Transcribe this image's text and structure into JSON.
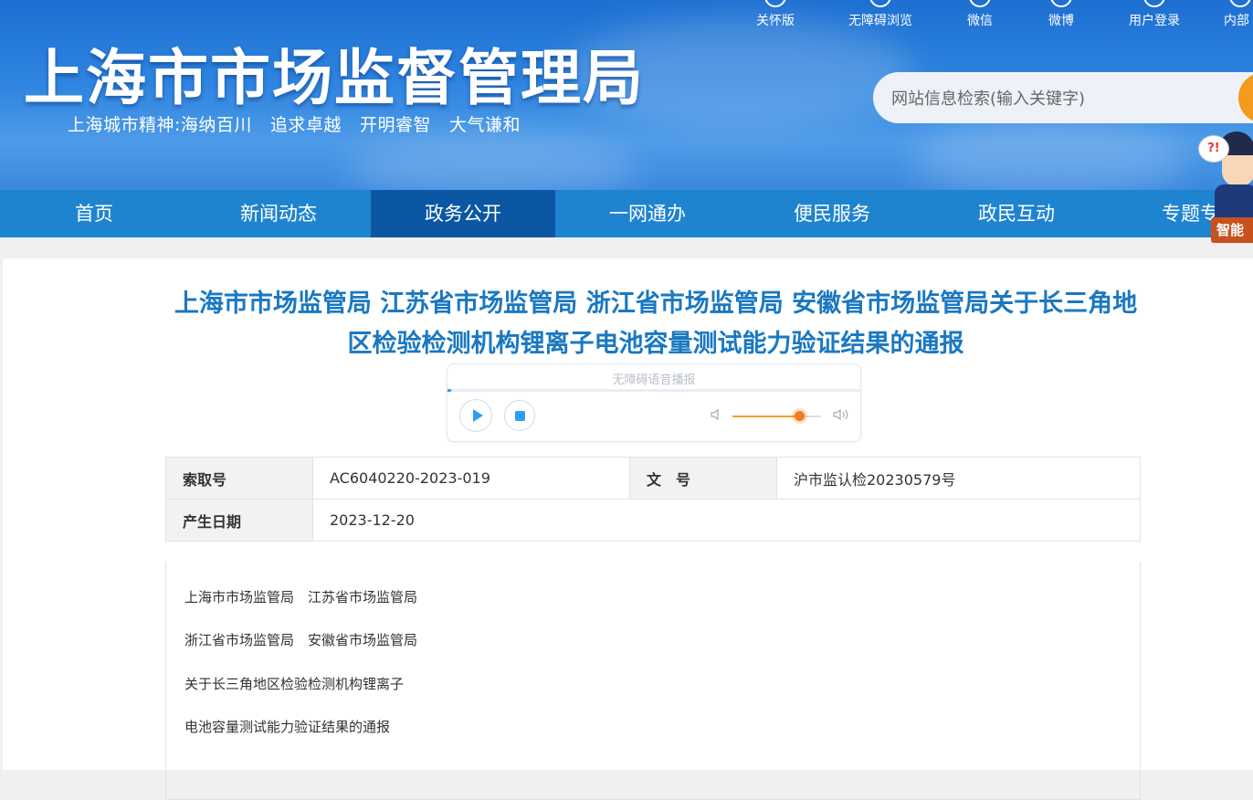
{
  "header": {
    "site_title": "上海市市场监督管理局",
    "slogan_prefix": "上海城市精神:",
    "slogan_parts": [
      "海纳百川",
      "追求卓越",
      "开明睿智",
      "大气谦和"
    ],
    "top_links": [
      {
        "label": "关怀版",
        "icon": "elderly-care-icon"
      },
      {
        "label": "无障碍浏览",
        "icon": "accessibility-icon"
      },
      {
        "label": "微信",
        "icon": "wechat-icon"
      },
      {
        "label": "微博",
        "icon": "weibo-icon"
      },
      {
        "label": "用户登录",
        "icon": "user-icon"
      },
      {
        "label": "内部",
        "icon": "internal-icon"
      }
    ],
    "search_placeholder": "网站信息检索(输入关键字)",
    "assistant_label": "智能"
  },
  "nav": {
    "items": [
      "首页",
      "新闻动态",
      "政务公开",
      "一网通办",
      "便民服务",
      "政民互动",
      "专题专栏"
    ],
    "active_index": 2
  },
  "article": {
    "title": "上海市市场监管局 江苏省市场监管局 浙江省市场监管局 安徽省市场监管局关于长三角地区检验检测机构锂离子电池容量测试能力验证结果的通报",
    "player": {
      "label": "无障碍语音播报",
      "volume": 0.75
    },
    "meta": {
      "index_no_label": "索取号",
      "index_no": "AC6040220-2023-019",
      "doc_no_label": "文　号",
      "doc_no": "沪市监认检20230579号",
      "date_label": "产生日期",
      "date": "2023-12-20"
    },
    "body_lines": [
      "上海市市场监管局　江苏省市场监管局",
      "浙江省市场监管局　安徽省市场监管局",
      "关于长三角地区检验检测机构锂离子",
      "电池容量测试能力验证结果的通报"
    ]
  },
  "colors": {
    "nav_bg": "#1f84d0",
    "nav_active": "#0b57a4",
    "title": "#1a78c2",
    "search_button": "#f39a1f"
  }
}
